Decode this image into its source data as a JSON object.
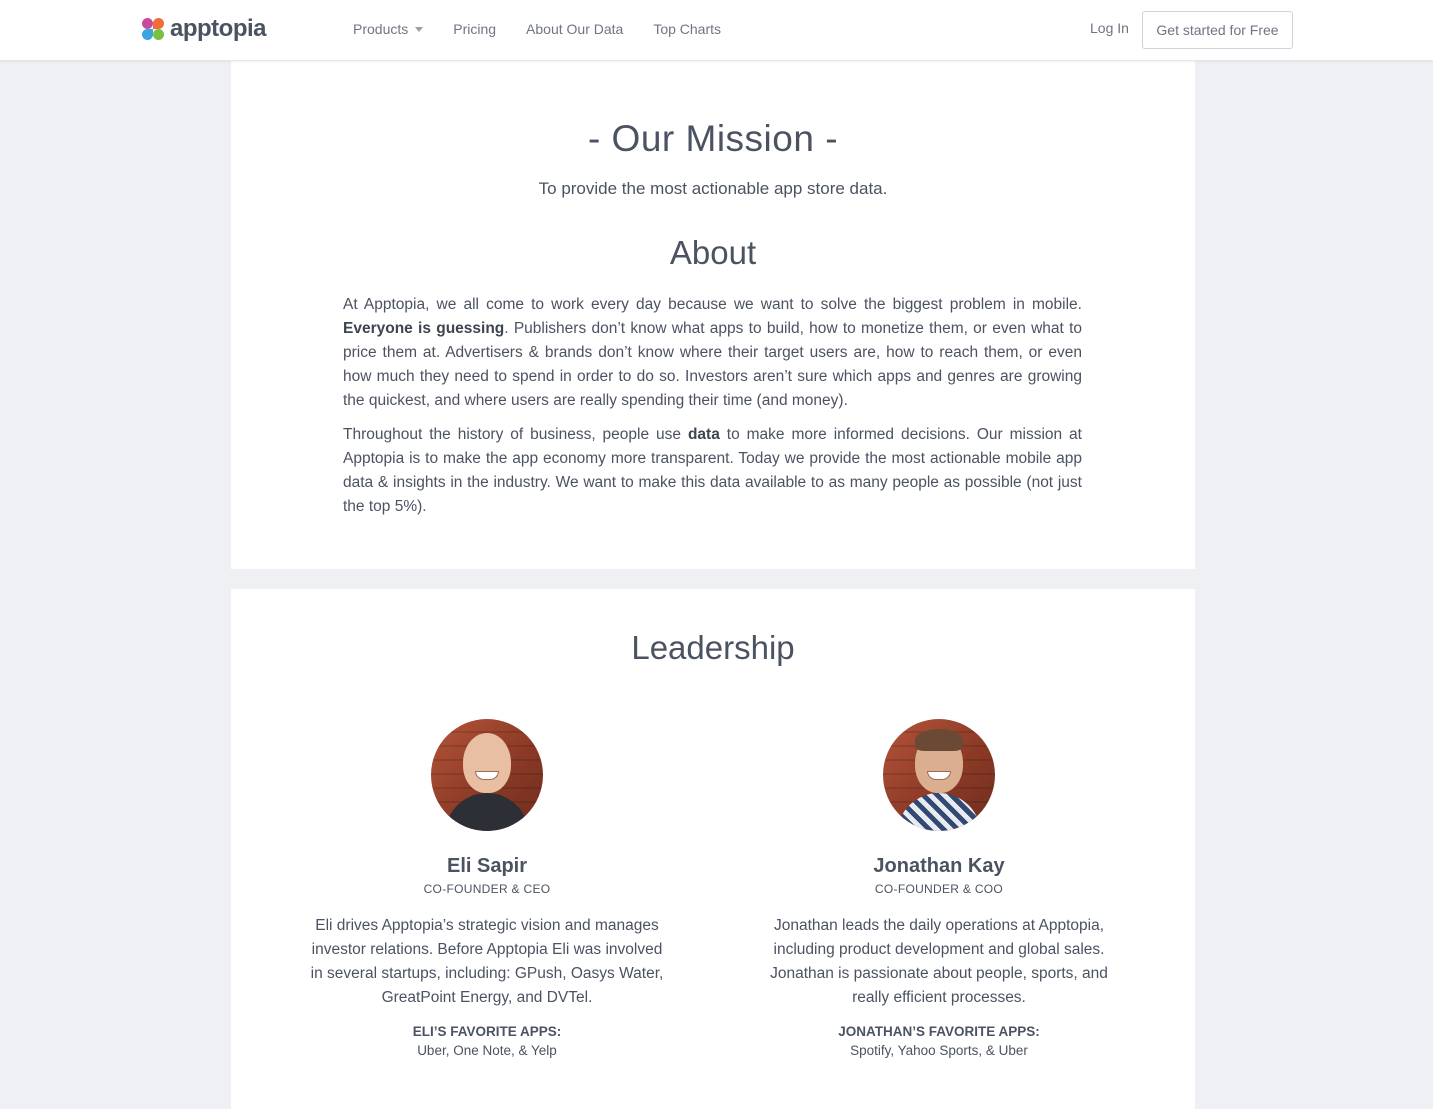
{
  "nav": {
    "logo_text": "apptopia",
    "products_label": "Products",
    "pricing_label": "Pricing",
    "about_data_label": "About Our Data",
    "top_charts_label": "Top Charts",
    "login_label": "Log In",
    "cta_label": "Get started for Free"
  },
  "mission": {
    "title": "- Our Mission -",
    "subtitle": "To provide the most actionable app store data."
  },
  "about": {
    "title": "About",
    "para1_lead": "At Apptopia, we all come to work every day because we want to solve the biggest problem in mobile. ",
    "para1_bold": "Everyone is guessing",
    "para1_rest": ". Publishers don’t know what apps to build, how to monetize them, or even what to price them at. Advertisers & brands don’t know where their target users are, how to reach them, or even how much they need to spend in order to do so. Investors aren’t sure which apps and genres are growing the quickest, and where users are really spending their time (and money).",
    "para2_lead": "Throughout the history of business, people use ",
    "para2_bold": "data",
    "para2_rest": " to make more informed decisions. Our mission at Apptopia is to make the app economy more transparent. Today we provide the most actionable mobile app data & insights in the industry. We want to make this data available to as many people as possible (not just the top 5%)."
  },
  "leadership": {
    "title": "Leadership",
    "people": [
      {
        "name": "Eli Sapir",
        "role": "CO-FOUNDER & CEO",
        "bio": "Eli drives Apptopia’s strategic vision and manages investor relations. Before Apptopia Eli was involved in several startups, including: GPush, Oasys Water, GreatPoint Energy, and DVTel.",
        "favs_label": "ELI’S FAVORITE APPS:",
        "favs": "Uber, One Note, & Yelp"
      },
      {
        "name": "Jonathan Kay",
        "role": "CO-FOUNDER & COO",
        "bio": "Jonathan leads the daily operations at Apptopia, including product development and global sales. Jonathan is passionate about people, sports, and really efficient processes.",
        "favs_label": "JONATHAN’S FAVORITE APPS:",
        "favs": "Spotify, Yahoo Sports, & Uber"
      }
    ]
  }
}
